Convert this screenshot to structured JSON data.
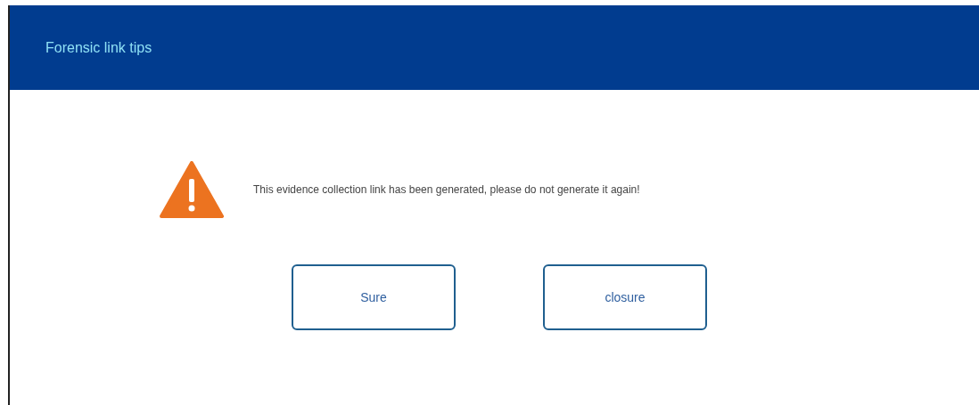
{
  "dialog": {
    "title": "Forensic link tips",
    "message": "This evidence collection link has been generated, please do not generate it again!"
  },
  "buttons": [
    {
      "label": "Sure"
    },
    {
      "label": "closure"
    }
  ]
}
